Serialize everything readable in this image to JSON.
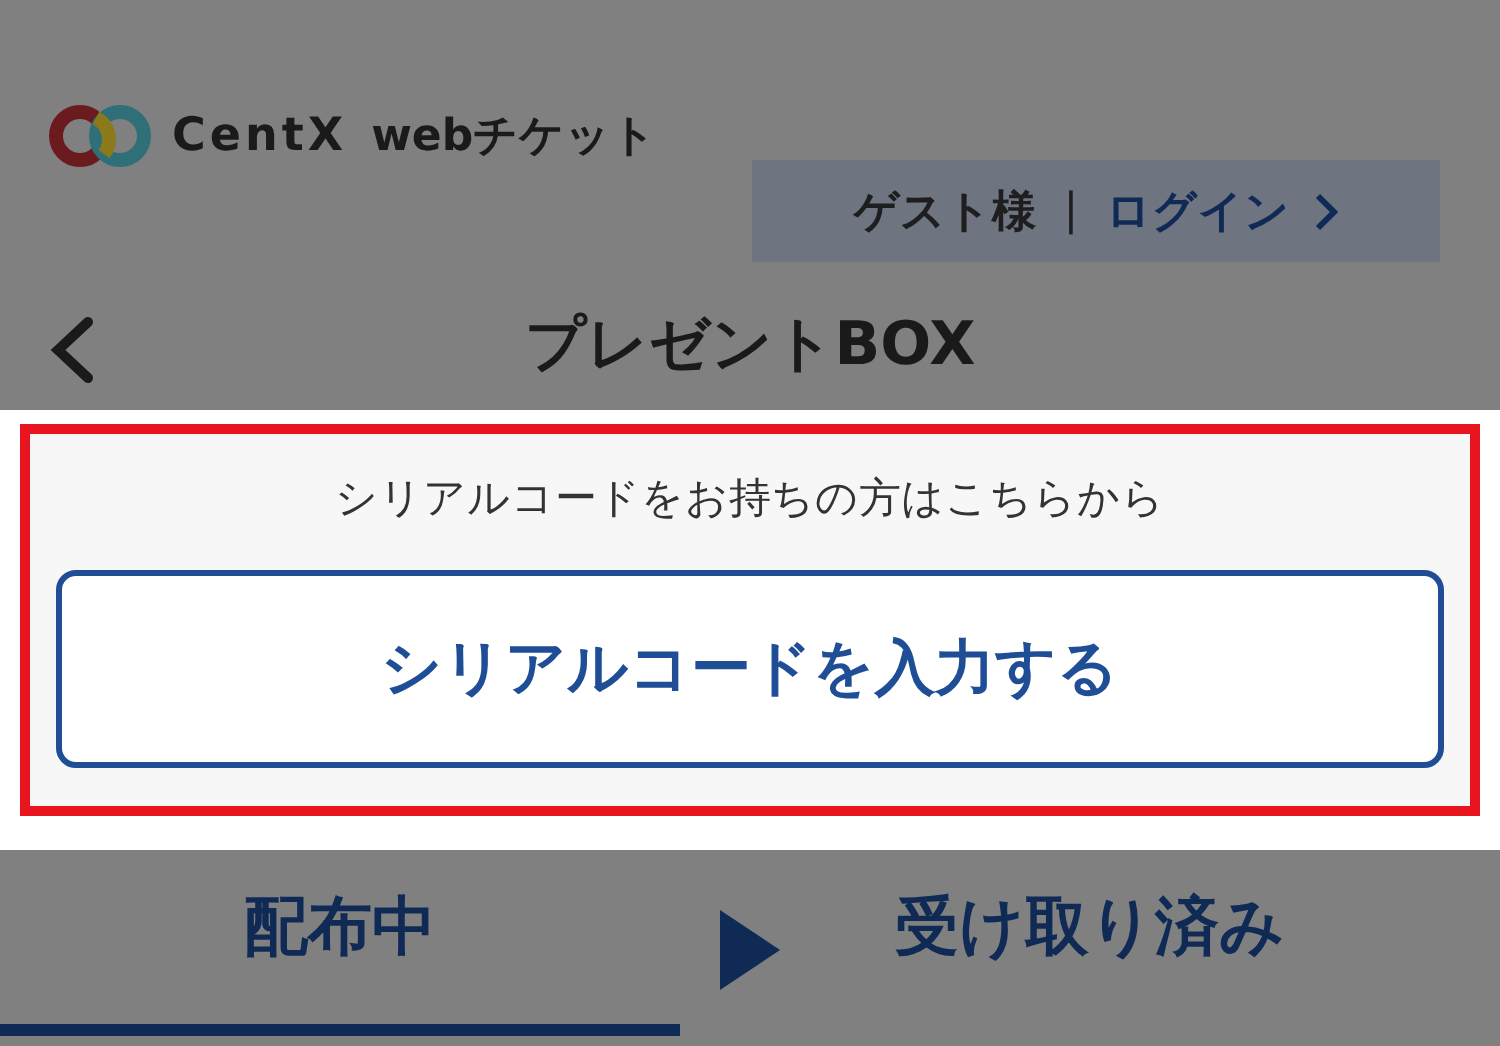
{
  "header": {
    "brand": "CentX",
    "brand_suffix": "webチケット",
    "guest": "ゲスト様",
    "separator": "|",
    "login": "ログイン"
  },
  "page_title": "プレゼントBOX",
  "serial": {
    "prompt": "シリアルコードをお持ちの方はこちらから",
    "button": "シリアルコードを入力する"
  },
  "tabs": [
    {
      "label": "配布中",
      "selected": true
    },
    {
      "label": "受け取り済み",
      "selected": false
    }
  ]
}
